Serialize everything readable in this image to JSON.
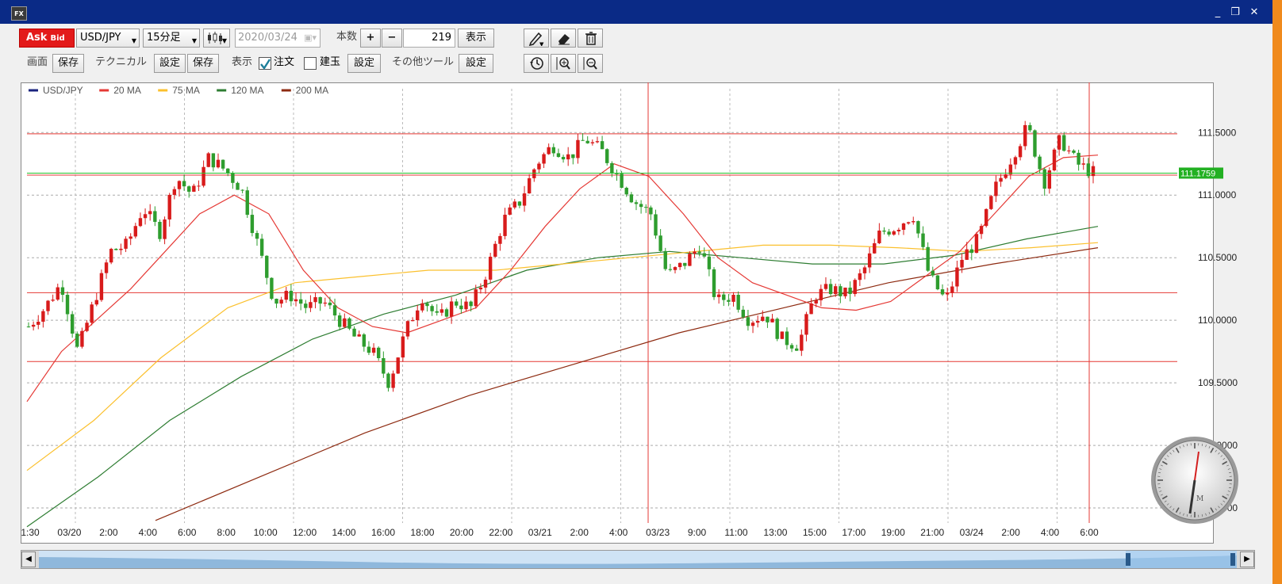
{
  "window": {
    "icon_text": "FX",
    "min": "_",
    "max": "❐",
    "close": "✕"
  },
  "toolbar": {
    "ask": "Ask",
    "bid": "Bid",
    "symbol": "USD/JPY",
    "timeframe": "15分足",
    "date_value": "2020/03/24",
    "count_label": "本数",
    "plus": "+",
    "minus": "−",
    "count_value": "219",
    "show_button": "表示"
  },
  "toolbar2": {
    "screen_label": "画面",
    "save1": "保存",
    "technical_label": "テクニカル",
    "setting1": "設定",
    "save2": "保存",
    "display_label": "表示",
    "order_label": "注文",
    "order_checked": true,
    "position_label": "建玉",
    "position_checked": false,
    "setting2": "設定",
    "other_tools_label": "その他ツール",
    "setting3": "設定"
  },
  "legend": [
    {
      "name": "USD/JPY",
      "color": "#1a237e"
    },
    {
      "name": "20 MA",
      "color": "#e53935"
    },
    {
      "name": "75 MA",
      "color": "#fbc02d"
    },
    {
      "name": "120 MA",
      "color": "#2e7d32"
    },
    {
      "name": "200 MA",
      "color": "#8d2a10"
    }
  ],
  "chart_data": {
    "type": "line",
    "symbol": "USD/JPY",
    "ylim": [
      108.38,
      111.85
    ],
    "y_ticks": [
      "111.5000",
      "111.0000",
      "110.5000",
      "110.0000",
      "109.5000",
      "109.0000",
      "108.5000"
    ],
    "x_ticks": [
      "1:30",
      "03/20",
      "2:00",
      "4:00",
      "6:00",
      "8:00",
      "10:00",
      "12:00",
      "14:00",
      "16:00",
      "18:00",
      "20:00",
      "22:00",
      "03/21",
      "2:00",
      "4:00",
      "03/23",
      "9:00",
      "11:00",
      "13:00",
      "15:00",
      "17:00",
      "19:00",
      "21:00",
      "03/24",
      "2:00",
      "4:00",
      "6:00"
    ],
    "current_price": "111.1759",
    "horizontal_lines": [
      111.49,
      111.16,
      110.22,
      109.67
    ],
    "price_series": [
      109.95,
      110.1,
      110.3,
      109.75,
      110.15,
      110.55,
      110.6,
      110.9,
      110.7,
      111.15,
      111.0,
      111.3,
      111.2,
      111.05,
      110.6,
      110.15,
      110.2,
      110.1,
      110.15,
      110.0,
      109.85,
      109.75,
      109.5,
      109.9,
      110.2,
      110.0,
      110.15,
      110.1,
      110.4,
      110.8,
      110.95,
      111.25,
      111.4,
      111.3,
      111.45,
      111.35,
      111.15,
      110.95,
      110.85,
      110.35,
      110.45,
      110.6,
      110.15,
      110.2,
      110.0,
      110.05,
      109.85,
      109.8,
      110.2,
      110.25,
      110.2,
      110.4,
      110.7,
      110.75,
      110.85,
      110.35,
      110.15,
      110.5,
      110.65,
      111.05,
      111.3,
      111.55,
      111.1,
      111.45,
      111.25,
      111.18
    ],
    "ma20": [
      109.35,
      109.75,
      110.0,
      110.25,
      110.55,
      110.85,
      111.0,
      110.85,
      110.4,
      110.1,
      109.95,
      109.9,
      110.0,
      110.1,
      110.4,
      110.75,
      111.05,
      111.25,
      111.15,
      110.85,
      110.5,
      110.3,
      110.2,
      110.1,
      110.08,
      110.15,
      110.35,
      110.55,
      110.85,
      111.15,
      111.3,
      111.32
    ],
    "ma75": [
      108.8,
      109.2,
      109.7,
      110.1,
      110.3,
      110.35,
      110.4,
      110.4,
      110.45,
      110.5,
      110.55,
      110.6,
      110.6,
      110.58,
      110.55,
      110.58,
      110.62
    ],
    "ma120": [
      108.35,
      108.75,
      109.2,
      109.55,
      109.85,
      110.05,
      110.2,
      110.4,
      110.5,
      110.55,
      110.5,
      110.45,
      110.45,
      110.52,
      110.65,
      110.75
    ],
    "ma200": [
      108.4,
      108.75,
      109.1,
      109.4,
      109.65,
      109.9,
      110.1,
      110.3,
      110.45,
      110.58
    ]
  },
  "clock": {
    "label": "M"
  }
}
